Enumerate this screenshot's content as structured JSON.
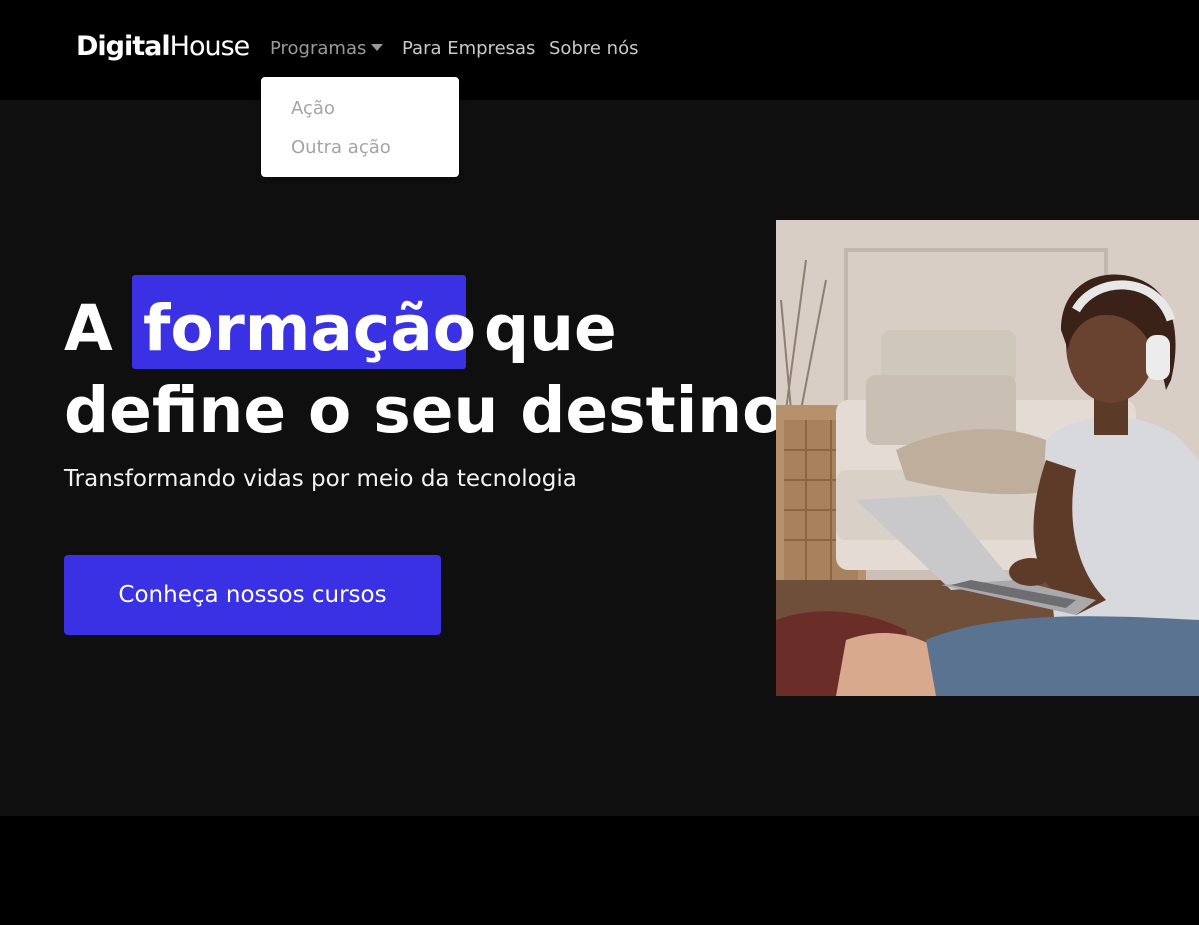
{
  "navbar": {
    "logo_part1": "Digital",
    "logo_part2": "House",
    "items": [
      {
        "label": "Programas"
      },
      {
        "label": "Para Empresas"
      },
      {
        "label": "Sobre nós"
      }
    ]
  },
  "dropdown": {
    "items": [
      {
        "label": "Ação"
      },
      {
        "label": "Outra ação"
      }
    ]
  },
  "hero": {
    "headline_word1": "A",
    "headline_highlight": "formação",
    "headline_word3": "que",
    "headline_line2": "define o seu destino",
    "subtitle": "Transformando vidas por meio da tecnologia",
    "cta_label": "Conheça nossos cursos"
  },
  "colors": {
    "accent": "#3b31e4",
    "hero_background": "#0f0f0f",
    "navbar_background": "#000000"
  }
}
